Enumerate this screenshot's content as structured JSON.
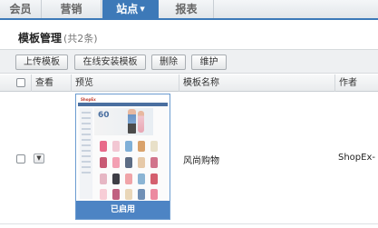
{
  "nav": {
    "tabs": [
      {
        "label": "会员"
      },
      {
        "label": "营销"
      },
      {
        "label": "站点",
        "active": true,
        "has_caret": true
      },
      {
        "label": "报表"
      }
    ],
    "caret_icon": "chevron-down-icon",
    "accent_color": "#3d79b8"
  },
  "page": {
    "title": "模板管理",
    "count": "(共2条)"
  },
  "toolbar": {
    "upload_label": "上传模板",
    "online_install_label": "在线安装模板",
    "delete_label": "删除",
    "maintain_label": "维护"
  },
  "table": {
    "columns": {
      "view": "查看",
      "preview": "预览",
      "name": "模板名称",
      "author": "作者"
    },
    "rows": [
      {
        "name": "风尚购物",
        "author": "ShopEx-",
        "status": "已启用",
        "thumb_logo": "ShopEx",
        "thumb_banner": "60"
      }
    ]
  }
}
